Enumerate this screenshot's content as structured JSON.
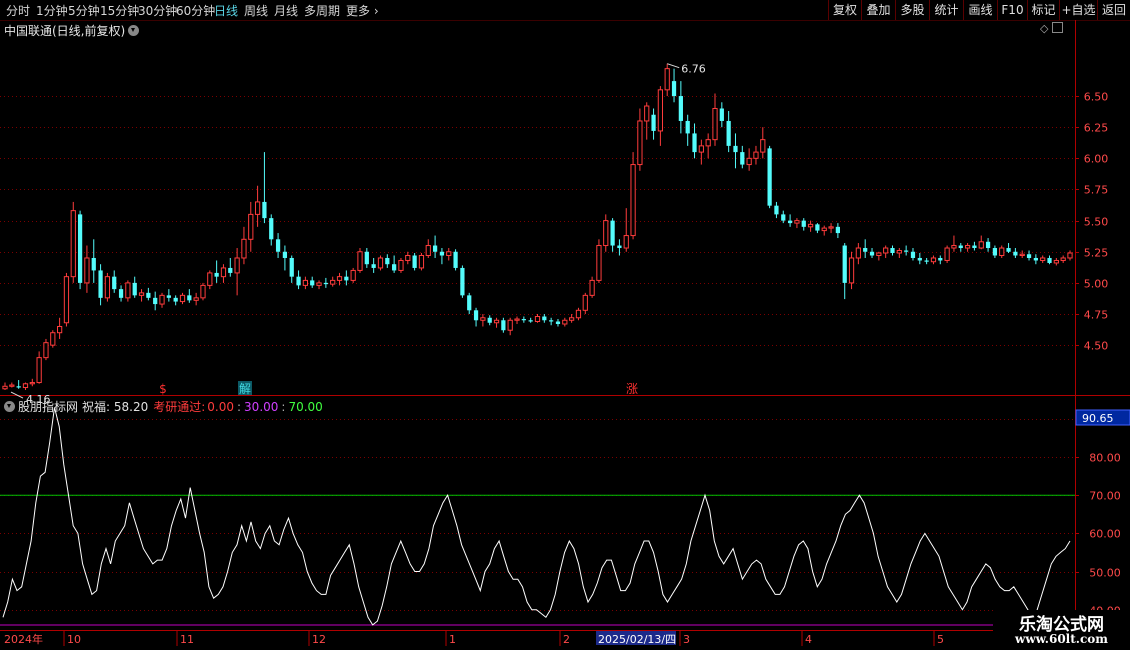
{
  "toolbar": {
    "periods": [
      "分时",
      "1分钟",
      "5分钟",
      "15分钟",
      "30分钟",
      "60分钟",
      "日线",
      "周线",
      "月线",
      "多周期",
      "更多"
    ],
    "active_period": "日线",
    "right_buttons": [
      "复权",
      "叠加",
      "多股",
      "统计",
      "画线",
      "F10",
      "标记",
      "+自选",
      "返回"
    ]
  },
  "main_title": "中国联通(日线,前复权)",
  "indicator": {
    "name": "股朋指标网",
    "zhufu_label": "祝福: 58.20",
    "kaoyan_label": "考研通过:",
    "values": [
      "0.00",
      "30.00",
      "70.00"
    ],
    "current_value": "90.65"
  },
  "signals": [
    {
      "text": "$",
      "color": "#ff3030"
    },
    {
      "text": "解",
      "color": "#40d8e0"
    },
    {
      "text": "涨",
      "color": "#ff3030"
    }
  ],
  "x_axis": {
    "year_label": "2024年",
    "ticks": [
      "10",
      "11",
      "12",
      "1",
      "2",
      "3",
      "4",
      "5"
    ],
    "highlight_date": "2025/02/13/四"
  },
  "watermark": {
    "title": "乐淘公式网",
    "url": "www.60lt.com"
  },
  "colors": {
    "up": "#ff3c3c",
    "down": "#54fcfc",
    "grid": "#7a0000",
    "axis": "#b00000",
    "line": "#ffffff",
    "upper_line": "#00c000",
    "lower_line": "#c000c0"
  },
  "chart_data": [
    {
      "type": "candlestick",
      "title": "中国联通(日线,前复权)",
      "y_ticks": [
        "6.50",
        "6.25",
        "6.00",
        "5.75",
        "5.50",
        "5.25",
        "5.00",
        "4.75",
        "4.50"
      ],
      "ylim": [
        4.1,
        6.95
      ],
      "max_label": "6.76",
      "min_label": "4.16",
      "ohlc": [
        [
          4.15,
          4.2,
          4.14,
          4.17
        ],
        [
          4.17,
          4.2,
          4.16,
          4.18
        ],
        [
          4.17,
          4.22,
          4.15,
          4.16
        ],
        [
          4.16,
          4.2,
          4.14,
          4.19
        ],
        [
          4.19,
          4.23,
          4.17,
          4.2
        ],
        [
          4.2,
          4.45,
          4.19,
          4.4
        ],
        [
          4.4,
          4.55,
          4.38,
          4.52
        ],
        [
          4.5,
          4.62,
          4.48,
          4.6
        ],
        [
          4.6,
          4.72,
          4.55,
          4.65
        ],
        [
          4.68,
          5.08,
          4.65,
          5.05
        ],
        [
          5.05,
          5.65,
          5.0,
          5.58
        ],
        [
          5.55,
          5.58,
          4.95,
          5.0
        ],
        [
          5.0,
          5.3,
          4.92,
          5.2
        ],
        [
          5.2,
          5.35,
          5.0,
          5.1
        ],
        [
          5.1,
          5.15,
          4.82,
          4.88
        ],
        [
          4.88,
          5.08,
          4.85,
          5.05
        ],
        [
          5.05,
          5.1,
          4.92,
          4.95
        ],
        [
          4.95,
          4.98,
          4.85,
          4.88
        ],
        [
          4.88,
          5.02,
          4.85,
          5.0
        ],
        [
          5.0,
          5.05,
          4.88,
          4.9
        ],
        [
          4.9,
          4.95,
          4.85,
          4.92
        ],
        [
          4.92,
          4.96,
          4.86,
          4.88
        ],
        [
          4.88,
          4.93,
          4.78,
          4.83
        ],
        [
          4.83,
          4.92,
          4.8,
          4.9
        ],
        [
          4.9,
          4.95,
          4.85,
          4.88
        ],
        [
          4.88,
          4.9,
          4.82,
          4.85
        ],
        [
          4.85,
          4.92,
          4.83,
          4.9
        ],
        [
          4.9,
          4.95,
          4.84,
          4.86
        ],
        [
          4.86,
          4.92,
          4.82,
          4.88
        ],
        [
          4.88,
          5.0,
          4.86,
          4.98
        ],
        [
          4.98,
          5.1,
          4.95,
          5.08
        ],
        [
          5.08,
          5.18,
          5.0,
          5.05
        ],
        [
          5.05,
          5.15,
          5.0,
          5.12
        ],
        [
          5.12,
          5.2,
          5.05,
          5.08
        ],
        [
          5.08,
          5.28,
          4.9,
          5.2
        ],
        [
          5.2,
          5.45,
          5.15,
          5.35
        ],
        [
          5.35,
          5.65,
          5.25,
          5.55
        ],
        [
          5.55,
          5.78,
          5.45,
          5.65
        ],
        [
          5.65,
          6.05,
          5.48,
          5.52
        ],
        [
          5.52,
          5.55,
          5.3,
          5.35
        ],
        [
          5.35,
          5.4,
          5.2,
          5.25
        ],
        [
          5.25,
          5.3,
          5.1,
          5.2
        ],
        [
          5.2,
          5.22,
          5.0,
          5.05
        ],
        [
          5.05,
          5.1,
          4.95,
          4.98
        ],
        [
          4.98,
          5.05,
          4.95,
          5.02
        ],
        [
          5.02,
          5.05,
          4.96,
          4.98
        ],
        [
          4.98,
          5.02,
          4.95,
          5.0
        ],
        [
          5.0,
          5.04,
          4.96,
          4.99
        ],
        [
          4.99,
          5.05,
          4.97,
          5.02
        ],
        [
          5.02,
          5.08,
          4.98,
          5.05
        ],
        [
          5.05,
          5.1,
          4.98,
          5.02
        ],
        [
          5.02,
          5.12,
          5.0,
          5.1
        ],
        [
          5.1,
          5.28,
          5.08,
          5.25
        ],
        [
          5.25,
          5.28,
          5.12,
          5.15
        ],
        [
          5.15,
          5.2,
          5.08,
          5.12
        ],
        [
          5.12,
          5.22,
          5.1,
          5.2
        ],
        [
          5.2,
          5.23,
          5.12,
          5.15
        ],
        [
          5.15,
          5.22,
          5.08,
          5.1
        ],
        [
          5.1,
          5.2,
          5.08,
          5.18
        ],
        [
          5.18,
          5.25,
          5.15,
          5.22
        ],
        [
          5.22,
          5.24,
          5.1,
          5.12
        ],
        [
          5.12,
          5.24,
          5.1,
          5.22
        ],
        [
          5.22,
          5.35,
          5.2,
          5.3
        ],
        [
          5.3,
          5.38,
          5.2,
          5.25
        ],
        [
          5.25,
          5.28,
          5.15,
          5.22
        ],
        [
          5.22,
          5.28,
          5.18,
          5.25
        ],
        [
          5.25,
          5.27,
          5.1,
          5.12
        ],
        [
          5.12,
          5.14,
          4.88,
          4.9
        ],
        [
          4.9,
          4.92,
          4.75,
          4.78
        ],
        [
          4.78,
          4.8,
          4.65,
          4.7
        ],
        [
          4.7,
          4.75,
          4.65,
          4.72
        ],
        [
          4.72,
          4.74,
          4.66,
          4.68
        ],
        [
          4.68,
          4.72,
          4.64,
          4.7
        ],
        [
          4.7,
          4.72,
          4.6,
          4.62
        ],
        [
          4.62,
          4.72,
          4.58,
          4.7
        ],
        [
          4.7,
          4.73,
          4.67,
          4.71
        ],
        [
          4.71,
          4.73,
          4.68,
          4.7
        ],
        [
          4.7,
          4.72,
          4.68,
          4.69
        ],
        [
          4.69,
          4.75,
          4.68,
          4.73
        ],
        [
          4.73,
          4.75,
          4.68,
          4.7
        ],
        [
          4.7,
          4.72,
          4.66,
          4.69
        ],
        [
          4.69,
          4.71,
          4.65,
          4.67
        ],
        [
          4.67,
          4.72,
          4.65,
          4.7
        ],
        [
          4.7,
          4.75,
          4.68,
          4.72
        ],
        [
          4.72,
          4.8,
          4.7,
          4.78
        ],
        [
          4.78,
          4.92,
          4.75,
          4.9
        ],
        [
          4.9,
          5.05,
          4.88,
          5.02
        ],
        [
          5.02,
          5.35,
          5.0,
          5.3
        ],
        [
          5.3,
          5.55,
          5.25,
          5.5
        ],
        [
          5.5,
          5.52,
          5.25,
          5.3
        ],
        [
          5.3,
          5.35,
          5.22,
          5.28
        ],
        [
          5.28,
          5.6,
          5.25,
          5.38
        ],
        [
          5.38,
          6.05,
          5.35,
          5.95
        ],
        [
          5.95,
          6.4,
          5.9,
          6.3
        ],
        [
          6.3,
          6.45,
          6.15,
          6.42
        ],
        [
          6.35,
          6.4,
          6.15,
          6.22
        ],
        [
          6.22,
          6.58,
          6.1,
          6.55
        ],
        [
          6.55,
          6.76,
          6.5,
          6.72
        ],
        [
          6.62,
          6.72,
          6.45,
          6.5
        ],
        [
          6.5,
          6.62,
          6.2,
          6.3
        ],
        [
          6.3,
          6.35,
          6.1,
          6.2
        ],
        [
          6.2,
          6.28,
          6.0,
          6.05
        ],
        [
          6.05,
          6.15,
          5.95,
          6.1
        ],
        [
          6.1,
          6.2,
          6.0,
          6.15
        ],
        [
          6.15,
          6.52,
          6.1,
          6.4
        ],
        [
          6.4,
          6.45,
          6.25,
          6.3
        ],
        [
          6.3,
          6.38,
          6.05,
          6.1
        ],
        [
          6.1,
          6.2,
          5.92,
          6.05
        ],
        [
          6.05,
          6.1,
          5.92,
          5.95
        ],
        [
          5.95,
          6.08,
          5.9,
          6.0
        ],
        [
          6.0,
          6.1,
          5.95,
          6.05
        ],
        [
          6.05,
          6.25,
          6.0,
          6.15
        ],
        [
          6.08,
          6.1,
          5.6,
          5.62
        ],
        [
          5.62,
          5.65,
          5.52,
          5.55
        ],
        [
          5.55,
          5.58,
          5.48,
          5.5
        ],
        [
          5.5,
          5.55,
          5.45,
          5.48
        ],
        [
          5.48,
          5.52,
          5.44,
          5.5
        ],
        [
          5.5,
          5.52,
          5.42,
          5.45
        ],
        [
          5.45,
          5.5,
          5.41,
          5.47
        ],
        [
          5.47,
          5.48,
          5.4,
          5.42
        ],
        [
          5.42,
          5.46,
          5.38,
          5.44
        ],
        [
          5.44,
          5.48,
          5.4,
          5.45
        ],
        [
          5.45,
          5.48,
          5.36,
          5.4
        ],
        [
          5.3,
          5.32,
          4.87,
          5.0
        ],
        [
          5.0,
          5.25,
          4.95,
          5.2
        ],
        [
          5.2,
          5.32,
          5.15,
          5.28
        ],
        [
          5.28,
          5.35,
          5.2,
          5.25
        ],
        [
          5.25,
          5.28,
          5.2,
          5.22
        ],
        [
          5.22,
          5.25,
          5.18,
          5.24
        ],
        [
          5.24,
          5.3,
          5.2,
          5.28
        ],
        [
          5.28,
          5.3,
          5.22,
          5.24
        ],
        [
          5.24,
          5.28,
          5.2,
          5.26
        ],
        [
          5.26,
          5.3,
          5.22,
          5.25
        ],
        [
          5.25,
          5.28,
          5.18,
          5.2
        ],
        [
          5.2,
          5.24,
          5.15,
          5.18
        ],
        [
          5.18,
          5.2,
          5.15,
          5.17
        ],
        [
          5.17,
          5.22,
          5.15,
          5.2
        ],
        [
          5.2,
          5.22,
          5.15,
          5.18
        ],
        [
          5.18,
          5.3,
          5.16,
          5.28
        ],
        [
          5.28,
          5.38,
          5.25,
          5.3
        ],
        [
          5.3,
          5.32,
          5.25,
          5.28
        ],
        [
          5.28,
          5.32,
          5.25,
          5.3
        ],
        [
          5.3,
          5.33,
          5.26,
          5.28
        ],
        [
          5.28,
          5.38,
          5.27,
          5.33
        ],
        [
          5.33,
          5.36,
          5.25,
          5.28
        ],
        [
          5.28,
          5.3,
          5.2,
          5.22
        ],
        [
          5.22,
          5.3,
          5.2,
          5.28
        ],
        [
          5.28,
          5.32,
          5.24,
          5.25
        ],
        [
          5.25,
          5.28,
          5.2,
          5.22
        ],
        [
          5.22,
          5.26,
          5.2,
          5.23
        ],
        [
          5.23,
          5.26,
          5.18,
          5.2
        ],
        [
          5.2,
          5.23,
          5.15,
          5.18
        ],
        [
          5.18,
          5.22,
          5.16,
          5.2
        ],
        [
          5.2,
          5.22,
          5.15,
          5.16
        ],
        [
          5.16,
          5.2,
          5.14,
          5.18
        ],
        [
          5.18,
          5.22,
          5.16,
          5.2
        ],
        [
          5.2,
          5.26,
          5.18,
          5.24
        ]
      ]
    },
    {
      "type": "line",
      "title": "股朋指标网",
      "y_ticks": [
        "90.00",
        "80.00",
        "70.00",
        "60.00",
        "50.00",
        "40.00"
      ],
      "ylim": [
        35.2,
        91.8
      ],
      "reference_lines": [
        70,
        30
      ],
      "values": [
        38,
        42,
        48,
        45,
        46,
        52,
        58,
        68,
        75,
        76,
        84,
        93,
        88,
        78,
        70,
        62,
        60,
        52,
        48,
        44,
        45,
        52,
        56,
        52,
        58,
        60,
        62,
        68,
        64,
        60,
        56,
        54,
        52,
        53,
        53,
        56,
        62,
        66,
        69,
        64,
        72,
        66,
        60,
        55,
        46,
        43,
        44,
        46,
        50,
        55,
        57,
        62,
        58,
        63,
        58,
        56,
        60,
        62,
        58,
        57,
        61,
        64,
        60,
        57,
        55,
        50,
        47,
        45,
        44,
        44,
        49,
        51,
        53,
        55,
        57,
        52,
        46,
        42,
        38,
        36,
        37,
        41,
        46,
        52,
        55,
        58,
        55,
        52,
        50,
        50,
        52,
        56,
        62,
        65,
        68,
        70,
        66,
        62,
        57,
        54,
        51,
        48,
        45,
        50,
        52,
        56,
        58,
        54,
        50,
        48,
        48,
        46,
        42,
        40,
        40,
        39,
        38,
        40,
        44,
        50,
        55,
        58,
        56,
        52,
        46,
        42,
        44,
        47,
        51,
        53,
        53,
        49,
        45,
        45,
        47,
        52,
        55,
        58,
        58,
        55,
        50,
        44,
        42,
        44,
        46,
        48,
        52,
        58,
        62,
        66,
        70,
        66,
        58,
        54,
        52,
        54,
        56,
        52,
        48,
        50,
        52,
        53,
        52,
        48,
        46,
        44,
        44,
        46,
        50,
        54,
        57,
        58,
        56,
        50,
        46,
        48,
        52,
        55,
        58,
        62,
        65,
        66,
        68,
        70,
        68,
        64,
        60,
        54,
        50,
        46,
        44,
        42,
        44,
        48,
        52,
        55,
        58,
        60,
        58,
        56,
        54,
        50,
        46,
        44,
        42,
        40,
        42,
        46,
        48,
        50,
        52,
        51,
        48,
        46,
        45,
        45,
        46,
        44,
        42,
        40,
        38,
        40,
        44,
        48,
        52,
        54,
        55,
        56,
        58
      ]
    }
  ]
}
